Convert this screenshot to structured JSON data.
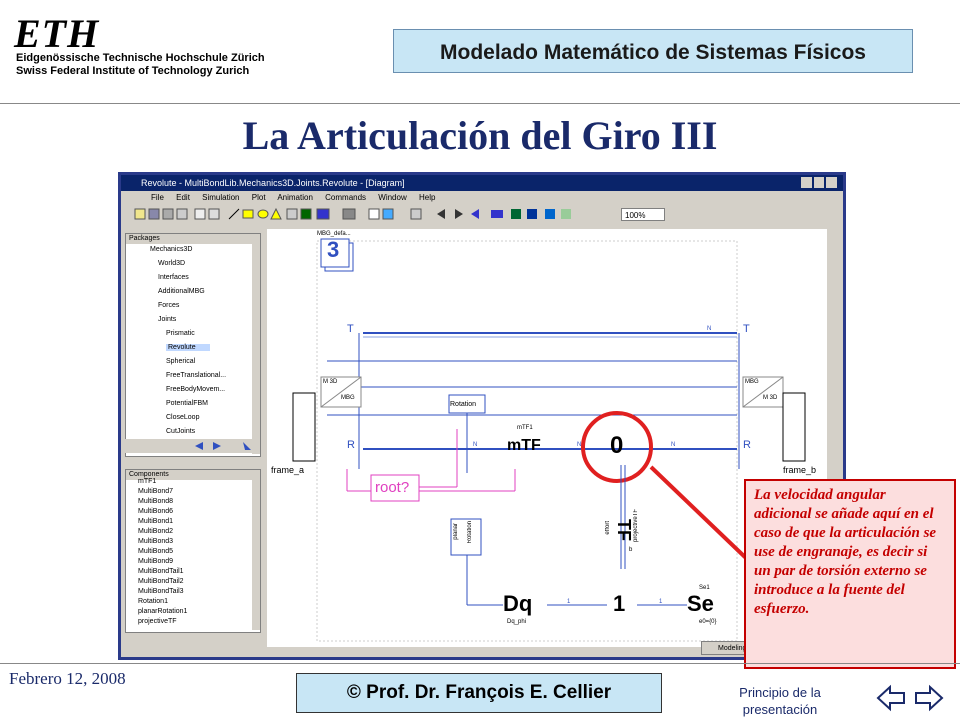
{
  "header": {
    "logo": "ETH",
    "institution_line1": "Eidgenössische Technische Hochschule Zürich",
    "institution_line2": "Swiss Federal Institute of Technology Zurich",
    "course_title": "Modelado Matemático de Sistemas Físicos"
  },
  "slide": {
    "title": "La Articulación del Giro III"
  },
  "window": {
    "title": "Revolute - MultiBondLib.Mechanics3D.Joints.Revolute - [Diagram]",
    "menu": [
      "File",
      "Edit",
      "Simulation",
      "Plot",
      "Animation",
      "Commands",
      "Window",
      "Help"
    ],
    "zoom": "100%",
    "status_button": "Modeling",
    "packages_header": "Packages",
    "packages": [
      "Mechanics3D",
      "World3D",
      "Interfaces",
      "AdditionalMBG",
      "Forces",
      "Joints",
      "Prismatic",
      "Revolute",
      "Spherical",
      "FreeTranslational...",
      "FreeBodyMovem...",
      "PotentialFBM",
      "CloseLoop",
      "CutJoints"
    ],
    "components_header": "Components",
    "components": [
      "mTF1",
      "MultiBond7",
      "MultiBond8",
      "MultiBond6",
      "MultiBond1",
      "MultiBond2",
      "MultiBond3",
      "MultiBond5",
      "MultiBond9",
      "MultiBondTail1",
      "MultiBondTail2",
      "MultiBondTail3",
      "Rotation1",
      "planarRotation1",
      "projectiveTF"
    ]
  },
  "diagram": {
    "icon_label": "MBG_defa...",
    "icon_number": "3",
    "T_left": "T",
    "T_right": "T",
    "R_left": "R",
    "R_right": "R",
    "N1": "N",
    "N2": "N",
    "N3": "N",
    "N4": "N",
    "M3D_left": "M 3D",
    "MBG_left": "MBG",
    "MBG_right": "MBG",
    "M3D_right": "M 3D",
    "frame_a": "frame_a",
    "frame_b": "frame_b",
    "rotation": "Rotation",
    "mTF1": "mTF1",
    "mTF": "mTF",
    "zero": "0",
    "root": "root?",
    "planar": "planar",
    "rotation2": "Rotation",
    "TF": "TF",
    "projectiveTF": "projectiveTF",
    "effort": "effort",
    "b": "b",
    "one_center": "1",
    "Dq": "Dq",
    "Dq_phi": "Dq_phi",
    "Se": "Se",
    "Se1": "Se1",
    "e0": "e0={0}",
    "bond1": "1",
    "bond2": "1"
  },
  "callout": {
    "text": "La velocidad angular adicional se añade aquí en el caso de que la articulación se use de engranaje, es decir si un par de torsión externo se introduce a la fuente del esfuerzo."
  },
  "footer": {
    "date": "Febrero 12, 2008",
    "copyright": "© Prof. Dr. François E. Cellier",
    "home_link": "Principio de la presentación"
  },
  "colors": {
    "title_blue": "#1a2a6a",
    "box_blue": "#c8e6f5",
    "callout_red": "#c40000",
    "window_frame": "#2a3a8a"
  }
}
